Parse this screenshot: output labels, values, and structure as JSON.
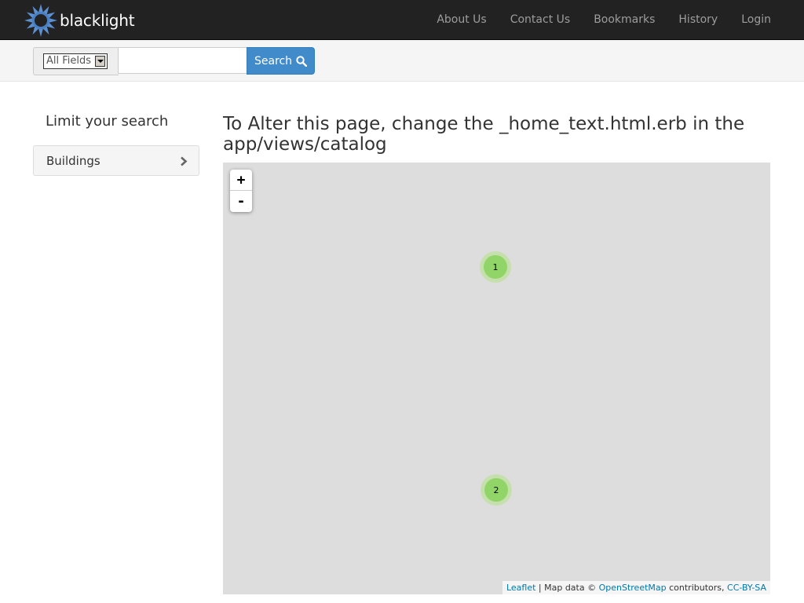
{
  "navbar": {
    "brand": "blacklight",
    "links": [
      "About Us",
      "Contact Us",
      "Bookmarks",
      "History",
      "Login"
    ]
  },
  "search": {
    "field_select": "All Fields",
    "query": "",
    "button_label": "Search"
  },
  "sidebar": {
    "heading": "Limit your search",
    "facets": [
      {
        "label": "Buildings"
      }
    ]
  },
  "main": {
    "title": "To Alter this page, change the _home_text.html.erb in the app/views/catalog"
  },
  "map": {
    "zoom_in": "+",
    "zoom_out": "-",
    "clusters": [
      "1",
      "2"
    ],
    "attribution": {
      "leaflet": "Leaflet",
      "sep1": " | Map data © ",
      "osm": "OpenStreetMap",
      "sep2": " contributors, ",
      "license": "CC-BY-SA"
    }
  },
  "colors": {
    "navbar_bg": "#222222",
    "nav_link": "#9d9d9d",
    "search_button": "#428bca",
    "map_bg": "#dddddd",
    "cluster_outer": "#b5e28c",
    "cluster_inner": "#6ecc39",
    "link": "#0078a8"
  },
  "icons": {
    "logo": "blacklight-sun-logo",
    "search_button": "search-icon",
    "facet_toggle": "chevron-right-icon"
  }
}
